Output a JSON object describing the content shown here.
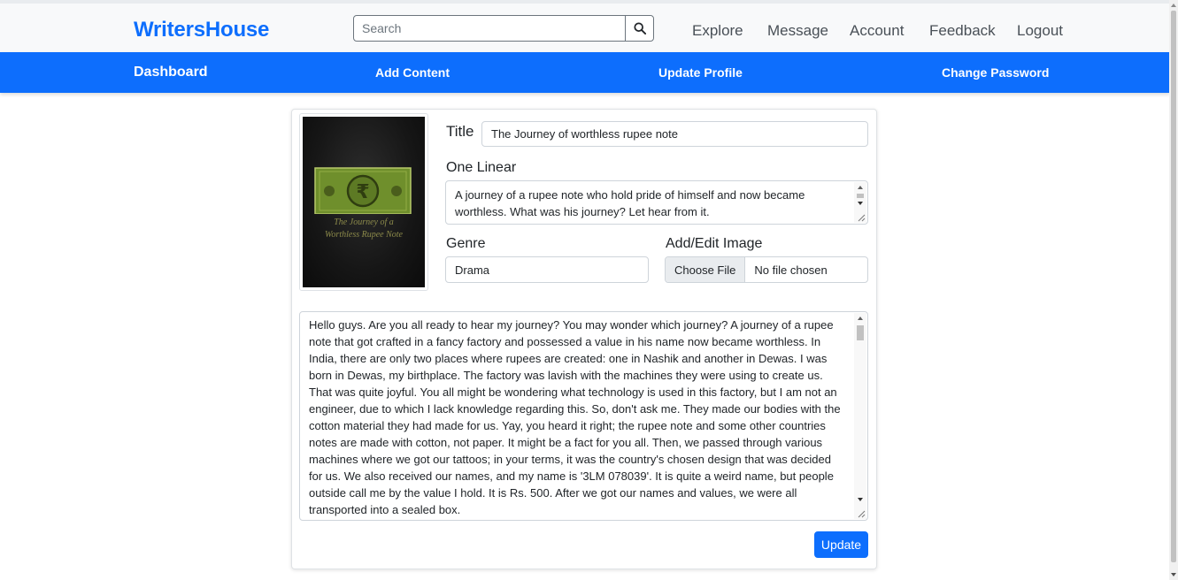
{
  "header": {
    "brand": "WritersHouse",
    "search_placeholder": "Search",
    "nav": [
      "Explore",
      "Message",
      "Account",
      "Feedback",
      "Logout"
    ]
  },
  "subnav": {
    "items": [
      "Dashboard",
      "Add Content",
      "Update Profile",
      "Change Password"
    ]
  },
  "cover": {
    "title_text": "The Journey of a\nWorthless Rupee Note",
    "currency_symbol": "₹"
  },
  "form": {
    "title_label": "Title",
    "title_value": "The Journey of worthless rupee note",
    "one_linear_label": "One Linear",
    "one_linear_value": "A journey of a rupee note who hold pride of himself and now became worthless. What was his journey? Let hear from it.",
    "genre_label": "Genre",
    "genre_value": "Drama",
    "image_label": "Add/Edit Image",
    "file_button": "Choose File",
    "file_status": "No file chosen",
    "content": "   Hello guys. Are you all ready to hear my journey? You may wonder which journey? A journey of a rupee note that got crafted in a fancy factory and possessed a value in his name now became worthless. In India, there are only two places where rupees are created: one in Nashik and another in Dewas. I was born in Dewas, my birthplace. The factory was lavish with the machines they were using to create us. That was quite joyful. You all might be wondering what technology is used in this factory, but I am not an engineer, due to which I lack knowledge regarding this. So, don't ask me. They made our bodies with the cotton material they had made for us. Yay, you heard it right; the rupee note and some other countries notes are made with cotton, not paper. It might be a fact for you all. Then, we passed through various machines where we got our tattoos; in your terms, it was the country's chosen design that was decided for us. We also received our names, and my name is '3LM 078039'. It is quite a weird name, but people outside call me by the value I hold. It is Rs. 500. After we got our names and values, we were all transported into a sealed box.\n  I was hoping to see daylight for the first time, but it was stolen by that bloody sealed box. I and my siblings",
    "update_button": "Update"
  },
  "colors": {
    "brand": "#0d6efd",
    "subnav_bg": "#0d6efd",
    "note_green": "#6f8f2c"
  }
}
